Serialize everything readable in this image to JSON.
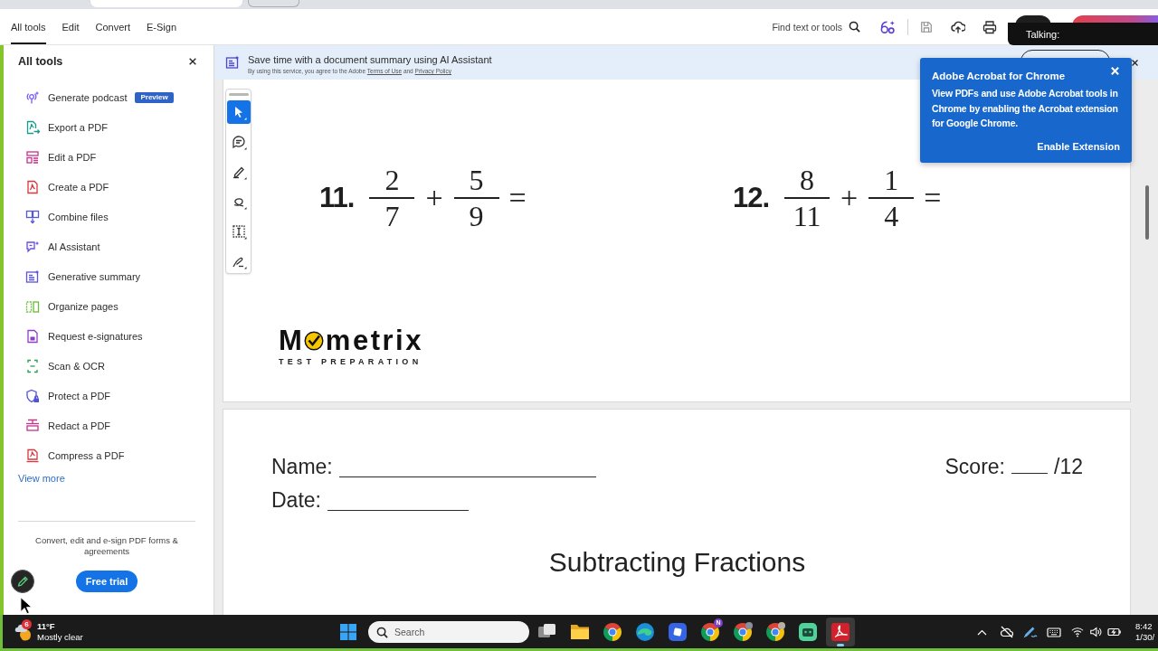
{
  "menu_bar": {
    "tabs": [
      {
        "label": "All tools",
        "selected": true
      },
      {
        "label": "Edit",
        "selected": false
      },
      {
        "label": "Convert",
        "selected": false
      },
      {
        "label": "E-Sign",
        "selected": false
      }
    ],
    "find_label": "Find text or tools"
  },
  "talking_overlay": {
    "label": "Talking:"
  },
  "sidebar": {
    "title": "All tools",
    "items": [
      {
        "label": "Generate podcast",
        "badge": "Preview"
      },
      {
        "label": "Export a PDF"
      },
      {
        "label": "Edit a PDF"
      },
      {
        "label": "Create a PDF"
      },
      {
        "label": "Combine files"
      },
      {
        "label": "AI Assistant"
      },
      {
        "label": "Generative summary"
      },
      {
        "label": "Organize pages"
      },
      {
        "label": "Request e-signatures"
      },
      {
        "label": "Scan & OCR"
      },
      {
        "label": "Protect a PDF"
      },
      {
        "label": "Redact a PDF"
      },
      {
        "label": "Compress a PDF"
      }
    ],
    "view_more": "View more",
    "promo": "Convert, edit and e-sign PDF forms & agreements",
    "trial_button": "Free trial"
  },
  "banner": {
    "message": "Save time with a document summary using AI Assistant",
    "disclaimer": "By using this service, you agree to the Adobe",
    "links": [
      "Terms of Use",
      "Privacy Policy"
    ],
    "joiner": "and"
  },
  "tools_panel": {
    "tools": [
      {
        "selected": true
      },
      {
        "selected": false
      },
      {
        "selected": false
      },
      {
        "selected": false
      },
      {
        "selected": false
      },
      {
        "selected": false
      }
    ]
  },
  "page_1": {
    "problems": [
      {
        "number": "11.",
        "fractions": [
          {
            "numerator": "2",
            "denominator": "7"
          },
          {
            "numerator": "5",
            "denominator": "9"
          }
        ],
        "operator": "+",
        "equals": "="
      },
      {
        "number": "12.",
        "fractions": [
          {
            "numerator": "8",
            "denominator": "11"
          },
          {
            "numerator": "1",
            "denominator": "4"
          }
        ],
        "operator": "+",
        "equals": "="
      }
    ],
    "logo": {
      "lead": "M",
      "rest": "metrix",
      "tagline": "TEST PREPARATION"
    }
  },
  "page_2": {
    "name_label": "Name:",
    "date_label": "Date:",
    "score_label": "Score:",
    "score_total": "/12",
    "title": "Subtracting Fractions"
  },
  "popup": {
    "title": "Adobe Acrobat for Chrome",
    "body": "View PDFs and use Adobe Acrobat tools in Chrome by enabling the Acrobat extension for Google Chrome.",
    "action": "Enable Extension"
  },
  "taskbar": {
    "weather": {
      "badge": "6",
      "temperature": "11°F",
      "condition": "Mostly clear"
    },
    "search": {
      "placeholder": "Search"
    },
    "apps": [
      {
        "active": false
      },
      {
        "active": false
      },
      {
        "active": false
      },
      {
        "active": false
      },
      {
        "active": false
      },
      {
        "active": false,
        "badge": "N"
      },
      {
        "active": false
      },
      {
        "active": false
      },
      {
        "active": false
      },
      {
        "active": true
      }
    ],
    "clock": {
      "time": "8:42",
      "date": "1/30/"
    }
  }
}
